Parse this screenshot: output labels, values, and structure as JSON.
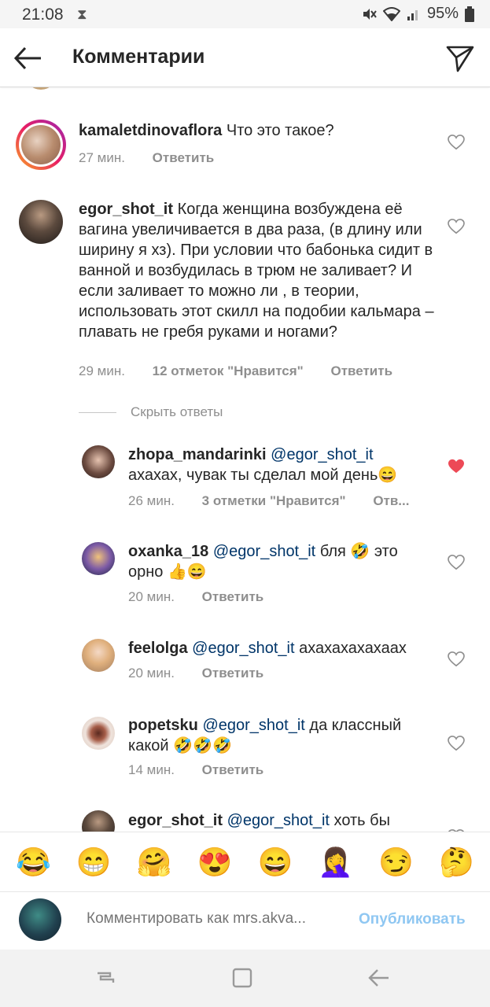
{
  "status_bar": {
    "time": "21:08",
    "hourglass_icon": "hourglass-icon",
    "battery": "95%"
  },
  "header": {
    "title": "Комментарии",
    "back_icon": "arrow-left-icon",
    "share_icon": "paper-plane-icon"
  },
  "labels": {
    "reply": "Ответить",
    "hide_replies": "Скрыть ответы"
  },
  "comments": [
    {
      "username": "kamaletdinovaflora",
      "text": "Что это такое?",
      "time": "27 мин.",
      "likes": "",
      "reply": "Ответить",
      "liked": false
    },
    {
      "username": "egor_shot_it",
      "text": "Когда женщина возбуждена её вагина увеличивается в два раза, (в длину или ширину я хз). При условии что бабонька сидит в ванной и возбудилась в трюм не заливает? И если заливает то можно ли , в теории, использовать этот скилл на подобии кальмара – плавать не гребя руками и ногами?",
      "time": "29 мин.",
      "likes": "12 отметок \"Нравится\"",
      "reply": "Ответить",
      "liked": false
    }
  ],
  "replies": [
    {
      "username": "zhopa_mandarinki",
      "mention": "@egor_shot_it",
      "text": "ахахах, чувак ты сделал мой день😄",
      "time": "26 мин.",
      "likes": "3 отметки \"Нравится\"",
      "reply": "Отв...",
      "liked": true
    },
    {
      "username": "oxanka_18",
      "mention": "@egor_shot_it",
      "text": "бля 🤣 это орно 👍😄",
      "time": "20 мин.",
      "likes": "",
      "reply": "Ответить",
      "liked": false
    },
    {
      "username": "feelolga",
      "mention": "@egor_shot_it",
      "text": "ахахахахахаах",
      "time": "20 мин.",
      "likes": "",
      "reply": "Ответить",
      "liked": false
    },
    {
      "username": "popetsku",
      "mention": "@egor_shot_it",
      "text": "да классный какой 🤣🤣🤣",
      "time": "14 мин.",
      "likes": "",
      "reply": "Ответить",
      "liked": false
    },
    {
      "username": "egor_shot_it",
      "mention": "@egor_shot_it",
      "text": "хоть бы",
      "time": "",
      "likes": "",
      "reply": "",
      "liked": false
    }
  ],
  "emoji_bar": [
    "😂",
    "😁",
    "🤗",
    "😍",
    "😄",
    "🤦‍♀️",
    "😏",
    "🤔"
  ],
  "input": {
    "placeholder": "Комментировать как mrs.akva...",
    "publish_label": "Опубликовать"
  },
  "colors": {
    "liked_heart": "#ed4956",
    "mention": "#003569",
    "meta_text": "#8e8e8e",
    "publish": "#8fc7f2"
  }
}
